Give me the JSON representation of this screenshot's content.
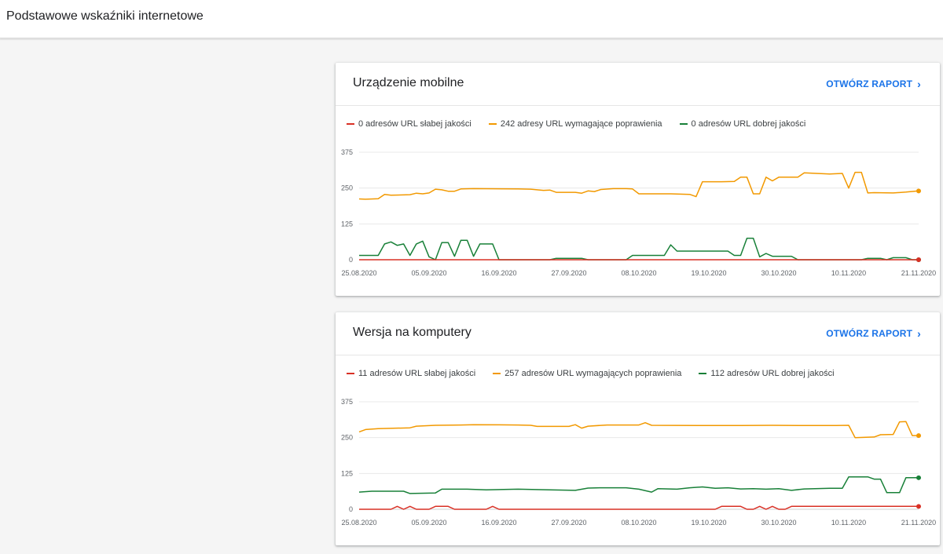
{
  "header": {
    "title": "Podstawowe wskaźniki internetowe"
  },
  "colors": {
    "poor": "#d93025",
    "needs": "#f29900",
    "good": "#188038",
    "accent": "#1a73e8",
    "grid": "#e8e8e8",
    "axis_text": "#5f6368"
  },
  "icons": {
    "open_report": "chevron-right-icon"
  },
  "cards": [
    {
      "title": "Urządzenie mobilne",
      "action_label": "OTWÓRZ RAPORT",
      "legend": [
        "0 adresów URL słabej jakości",
        "242 adresy URL wymagające poprawienia",
        "0 adresów URL dobrej jakości"
      ]
    },
    {
      "title": "Wersja na komputery",
      "action_label": "OTWÓRZ RAPORT",
      "legend": [
        "11 adresów URL słabej jakości",
        "257 adresów URL wymagających poprawienia",
        "112 adresów URL dobrej jakości"
      ]
    }
  ],
  "chart_data": [
    {
      "type": "line",
      "title": "",
      "x_ticks": [
        "25.08.2020",
        "05.09.2020",
        "16.09.2020",
        "27.09.2020",
        "08.10.2020",
        "19.10.2020",
        "30.10.2020",
        "10.11.2020",
        "21.11.2020"
      ],
      "y_ticks": [
        0,
        125,
        250,
        375
      ],
      "ylim": [
        0,
        375
      ],
      "xlim": [
        0,
        88
      ],
      "grid": true,
      "series": [
        {
          "name": "0 adresów URL słabej jakości",
          "color": "#d93025",
          "points": [
            [
              0,
              0
            ],
            [
              88,
              0
            ]
          ]
        },
        {
          "name": "242 adresy URL wymagające poprawienia",
          "color": "#f29900",
          "points": [
            [
              0,
              212
            ],
            [
              1,
              211
            ],
            [
              3,
              213
            ],
            [
              4,
              228
            ],
            [
              5,
              225
            ],
            [
              8,
              227
            ],
            [
              9,
              232
            ],
            [
              10,
              230
            ],
            [
              11,
              233
            ],
            [
              12,
              246
            ],
            [
              13,
              244
            ],
            [
              14,
              239
            ],
            [
              15,
              239
            ],
            [
              16,
              247
            ],
            [
              18,
              248
            ],
            [
              25,
              247
            ],
            [
              27,
              246
            ],
            [
              29,
              242
            ],
            [
              30,
              243
            ],
            [
              31,
              235
            ],
            [
              34,
              235
            ],
            [
              35,
              232
            ],
            [
              36,
              240
            ],
            [
              37,
              238
            ],
            [
              38,
              245
            ],
            [
              40,
              248
            ],
            [
              42,
              248
            ],
            [
              43,
              247
            ],
            [
              44,
              230
            ],
            [
              49,
              230
            ],
            [
              52,
              228
            ],
            [
              53,
              220
            ],
            [
              54,
              272
            ],
            [
              55,
              272
            ],
            [
              57,
              272
            ],
            [
              59,
              273
            ],
            [
              60,
              288
            ],
            [
              61,
              288
            ],
            [
              62,
              230
            ],
            [
              63,
              230
            ],
            [
              64,
              288
            ],
            [
              65,
              275
            ],
            [
              66,
              288
            ],
            [
              67,
              288
            ],
            [
              68,
              288
            ],
            [
              69,
              288
            ],
            [
              70,
              303
            ],
            [
              72,
              301
            ],
            [
              74,
              299
            ],
            [
              76,
              301
            ],
            [
              77,
              250
            ],
            [
              78,
              305
            ],
            [
              79,
              305
            ],
            [
              80,
              233
            ],
            [
              81,
              234
            ],
            [
              84,
              233
            ],
            [
              86,
              236
            ],
            [
              88,
              240
            ]
          ]
        },
        {
          "name": "0 adresów URL dobrej jakości",
          "color": "#188038",
          "points": [
            [
              0,
              15
            ],
            [
              3,
              15
            ],
            [
              4,
              55
            ],
            [
              5,
              62
            ],
            [
              6,
              50
            ],
            [
              7,
              55
            ],
            [
              8,
              15
            ],
            [
              9,
              55
            ],
            [
              10,
              65
            ],
            [
              11,
              10
            ],
            [
              12,
              0
            ],
            [
              13,
              60
            ],
            [
              14,
              60
            ],
            [
              15,
              12
            ],
            [
              16,
              68
            ],
            [
              17,
              68
            ],
            [
              18,
              12
            ],
            [
              19,
              55
            ],
            [
              20,
              55
            ],
            [
              21,
              55
            ],
            [
              22,
              0
            ],
            [
              30,
              0
            ],
            [
              31,
              5
            ],
            [
              35,
              5
            ],
            [
              36,
              0
            ],
            [
              42,
              0
            ],
            [
              43,
              15
            ],
            [
              45,
              15
            ],
            [
              48,
              15
            ],
            [
              49,
              52
            ],
            [
              50,
              30
            ],
            [
              58,
              30
            ],
            [
              59,
              15
            ],
            [
              60,
              15
            ],
            [
              61,
              75
            ],
            [
              62,
              75
            ],
            [
              63,
              10
            ],
            [
              64,
              22
            ],
            [
              65,
              12
            ],
            [
              68,
              12
            ],
            [
              69,
              0
            ],
            [
              79,
              0
            ],
            [
              80,
              5
            ],
            [
              82,
              5
            ],
            [
              83,
              0
            ],
            [
              84,
              7
            ],
            [
              86,
              7
            ],
            [
              87,
              0
            ],
            [
              88,
              0
            ]
          ]
        }
      ]
    },
    {
      "type": "line",
      "title": "",
      "x_ticks": [
        "25.08.2020",
        "05.09.2020",
        "16.09.2020",
        "27.09.2020",
        "08.10.2020",
        "19.10.2020",
        "30.10.2020",
        "10.11.2020",
        "21.11.2020"
      ],
      "y_ticks": [
        0,
        125,
        250,
        375
      ],
      "ylim": [
        0,
        375
      ],
      "xlim": [
        0,
        88
      ],
      "grid": true,
      "series": [
        {
          "name": "11 adresów URL słabej jakości",
          "color": "#d93025",
          "points": [
            [
              0,
              0
            ],
            [
              5,
              0
            ],
            [
              6,
              10
            ],
            [
              7,
              0
            ],
            [
              8,
              10
            ],
            [
              9,
              0
            ],
            [
              11,
              0
            ],
            [
              12,
              10
            ],
            [
              14,
              10
            ],
            [
              15,
              0
            ],
            [
              20,
              0
            ],
            [
              21,
              10
            ],
            [
              22,
              0
            ],
            [
              56,
              0
            ],
            [
              57,
              10
            ],
            [
              60,
              10
            ],
            [
              61,
              0
            ],
            [
              62,
              0
            ],
            [
              63,
              10
            ],
            [
              64,
              0
            ],
            [
              65,
              10
            ],
            [
              66,
              0
            ],
            [
              67,
              0
            ],
            [
              68,
              10
            ],
            [
              88,
              10
            ]
          ]
        },
        {
          "name": "257 adresów URL wymagających poprawienia",
          "color": "#f29900",
          "points": [
            [
              0,
              270
            ],
            [
              1,
              278
            ],
            [
              3,
              281
            ],
            [
              8,
              284
            ],
            [
              9,
              290
            ],
            [
              12,
              293
            ],
            [
              16,
              294
            ],
            [
              18,
              295
            ],
            [
              25,
              294
            ],
            [
              27,
              293
            ],
            [
              28,
              289
            ],
            [
              33,
              289
            ],
            [
              34,
              295
            ],
            [
              35,
              283
            ],
            [
              36,
              290
            ],
            [
              39,
              294
            ],
            [
              44,
              294
            ],
            [
              45,
              302
            ],
            [
              46,
              293
            ],
            [
              55,
              292
            ],
            [
              60,
              292
            ],
            [
              65,
              293
            ],
            [
              70,
              292
            ],
            [
              75,
              292
            ],
            [
              77,
              293
            ],
            [
              78,
              250
            ],
            [
              81,
              252
            ],
            [
              82,
              260
            ],
            [
              84,
              261
            ],
            [
              85,
              305
            ],
            [
              86,
              306
            ],
            [
              87,
              257
            ],
            [
              88,
              257
            ]
          ]
        },
        {
          "name": "112 adresów URL dobrej jakości",
          "color": "#188038",
          "points": [
            [
              0,
              60
            ],
            [
              2,
              63
            ],
            [
              7,
              63
            ],
            [
              8,
              55
            ],
            [
              12,
              57
            ],
            [
              13,
              70
            ],
            [
              17,
              70
            ],
            [
              20,
              68
            ],
            [
              25,
              70
            ],
            [
              30,
              68
            ],
            [
              34,
              66
            ],
            [
              36,
              74
            ],
            [
              38,
              75
            ],
            [
              40,
              75
            ],
            [
              42,
              75
            ],
            [
              44,
              70
            ],
            [
              46,
              60
            ],
            [
              47,
              72
            ],
            [
              50,
              70
            ],
            [
              52,
              75
            ],
            [
              54,
              78
            ],
            [
              56,
              73
            ],
            [
              58,
              75
            ],
            [
              60,
              71
            ],
            [
              62,
              72
            ],
            [
              64,
              70
            ],
            [
              66,
              72
            ],
            [
              68,
              66
            ],
            [
              70,
              71
            ],
            [
              74,
              73
            ],
            [
              76,
              73
            ],
            [
              77,
              113
            ],
            [
              78,
              113
            ],
            [
              80,
              113
            ],
            [
              81,
              105
            ],
            [
              82,
              105
            ],
            [
              83,
              58
            ],
            [
              84,
              58
            ],
            [
              85,
              58
            ],
            [
              86,
              110
            ],
            [
              87,
              110
            ],
            [
              88,
              110
            ]
          ]
        }
      ]
    }
  ]
}
